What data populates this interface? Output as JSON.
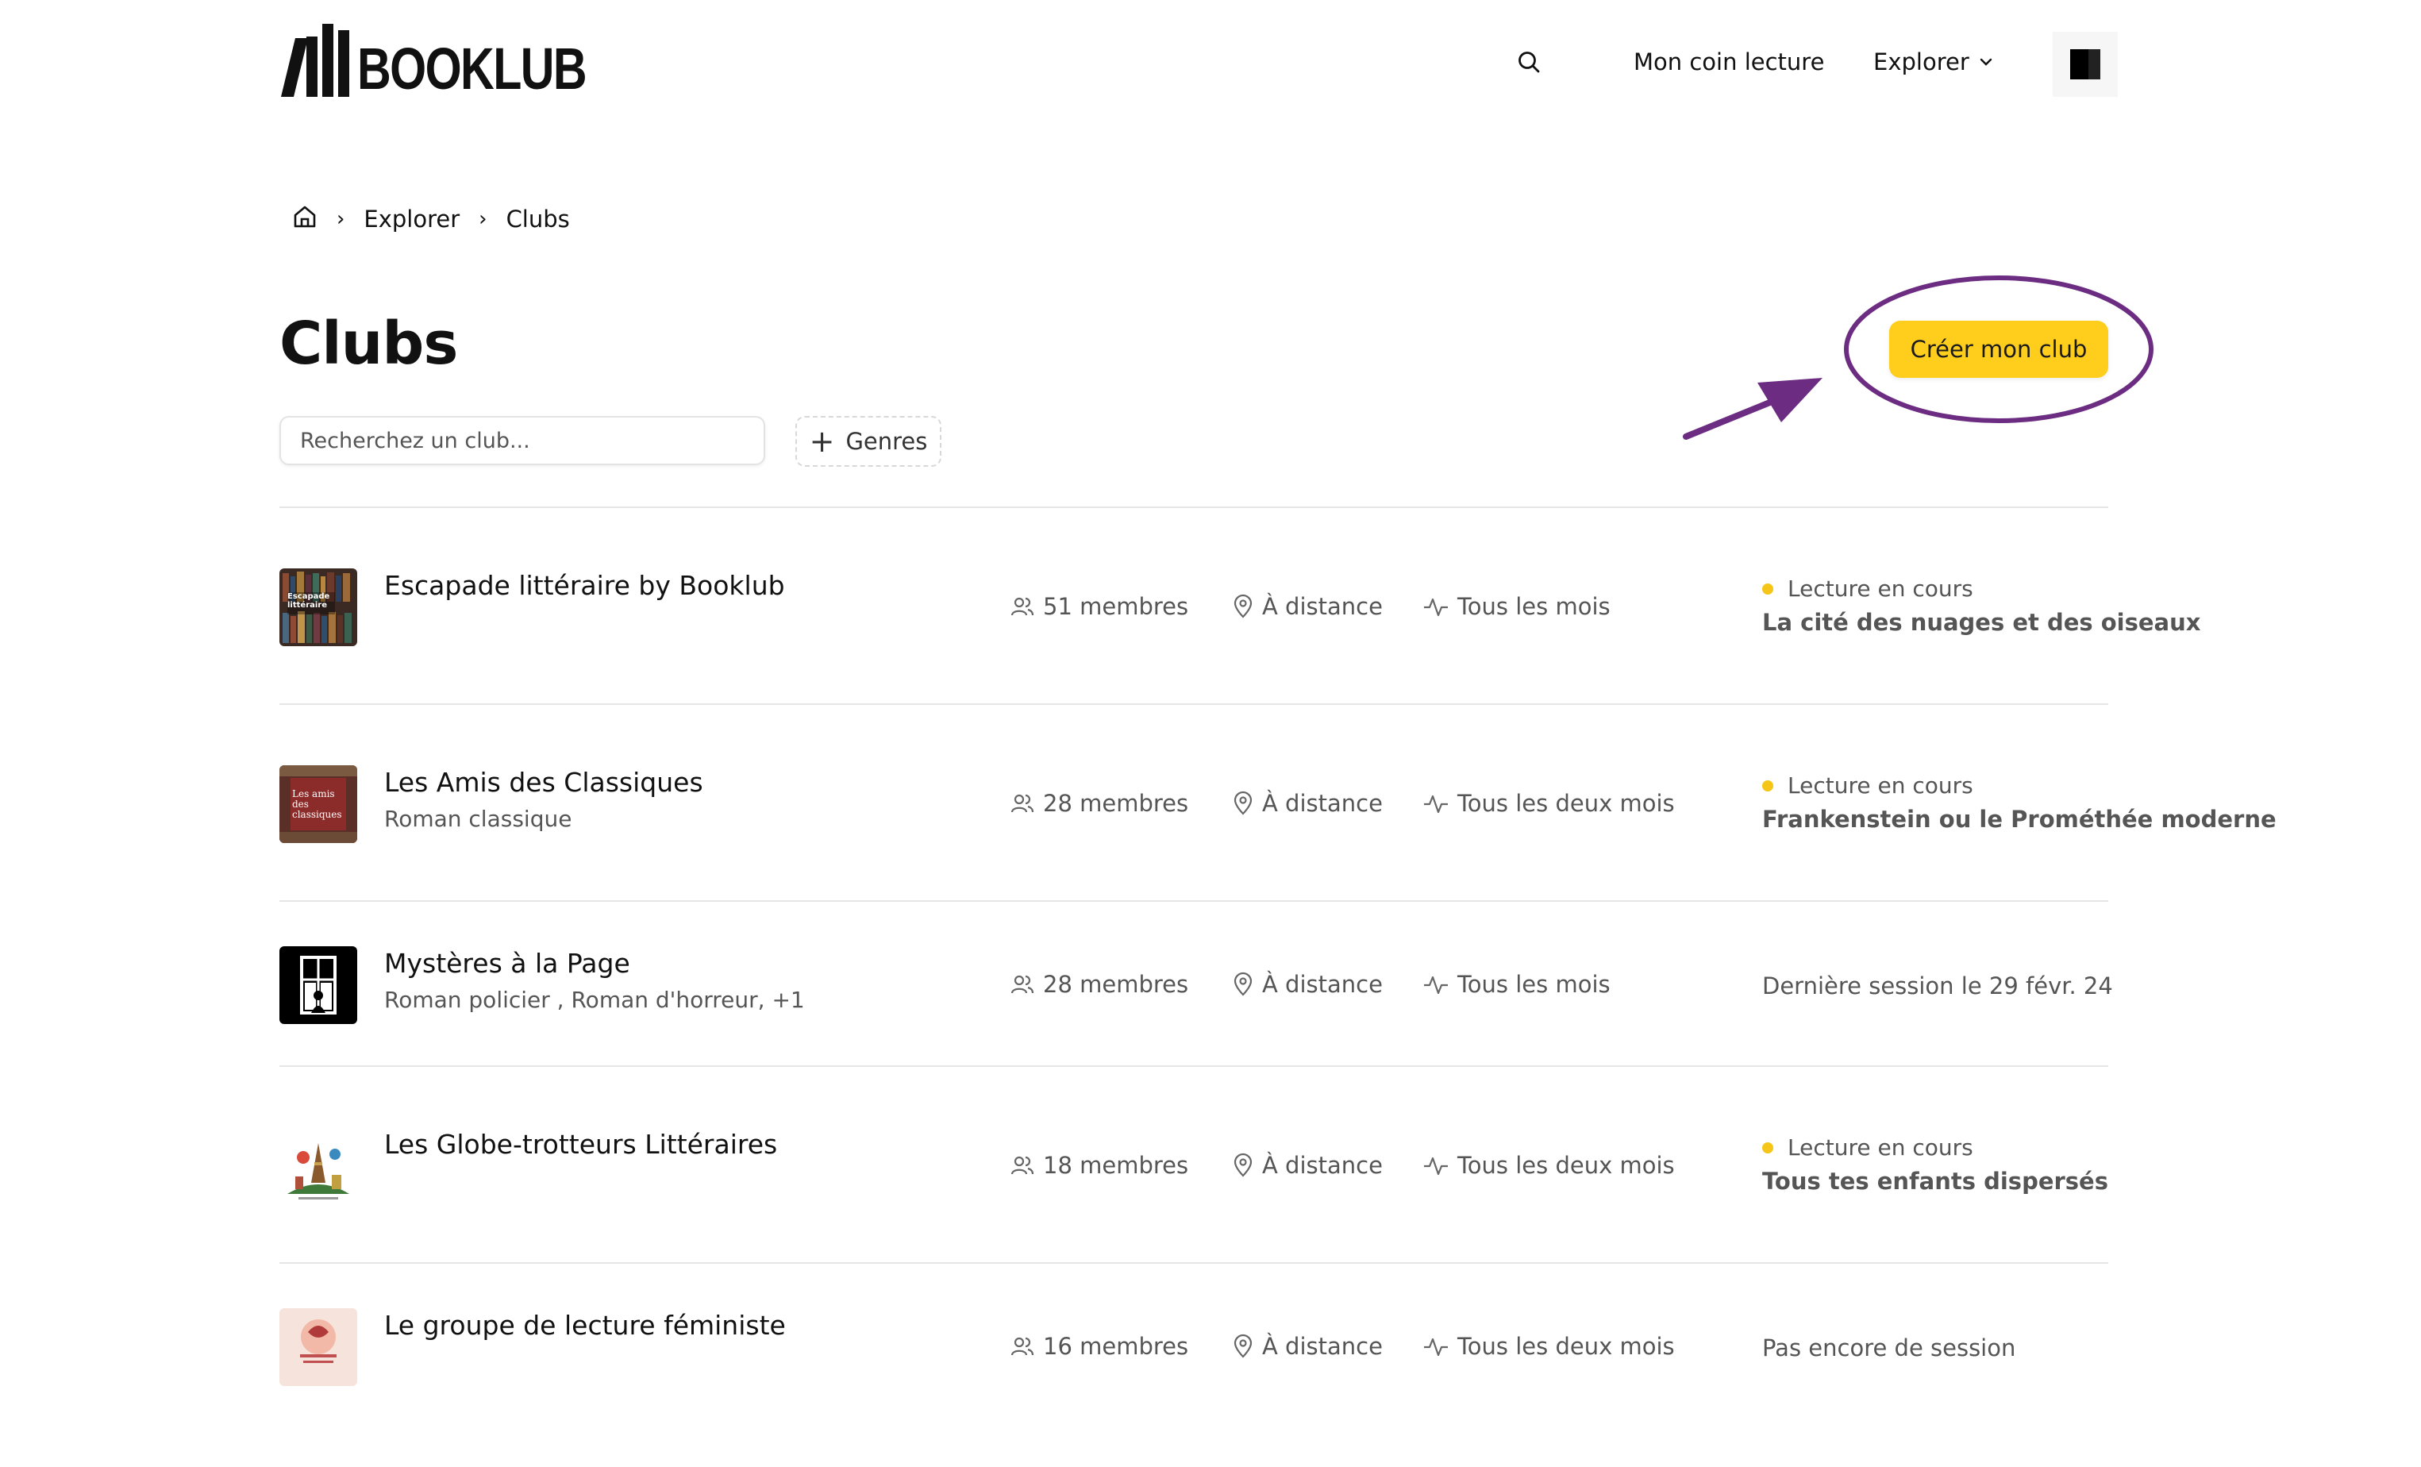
{
  "header": {
    "logo_text": "BOOKLUB",
    "nav": {
      "search_icon": "search-icon",
      "coin_lecture": "Mon coin lecture",
      "explorer": "Explorer"
    }
  },
  "breadcrumb": {
    "home_icon": "home-icon",
    "items": [
      "Explorer",
      "Clubs"
    ]
  },
  "page": {
    "title": "Clubs",
    "search_placeholder": "Recherchez un club...",
    "genres_label": "Genres",
    "create_label": "Créer mon club"
  },
  "colors": {
    "accent_yellow": "#ffcd1c",
    "annotation_purple": "#6b2c82",
    "status_dot": "#f5c518"
  },
  "clubs": [
    {
      "name": "Escapade littéraire by Booklub",
      "genre": "",
      "members": "51 membres",
      "location": "À distance",
      "frequency": "Tous les mois",
      "status_label": "Lecture en cours",
      "book": "La cité des nuages et des oiseaux",
      "cover_text": "Escapade littéraire"
    },
    {
      "name": "Les Amis des Classiques",
      "genre": "Roman classique",
      "members": "28 membres",
      "location": "À distance",
      "frequency": "Tous les deux mois",
      "status_label": "Lecture en cours",
      "book": "Frankenstein ou le Prométhée moderne",
      "cover_text": "Les amis des classiques"
    },
    {
      "name": "Mystères à la Page",
      "genre": "Roman policier , Roman d'horreur, +1",
      "members": "28 membres",
      "location": "À distance",
      "frequency": "Tous les mois",
      "status_text": "Dernière session le 29 févr. 24"
    },
    {
      "name": "Les Globe-trotteurs Littéraires",
      "genre": "",
      "members": "18 membres",
      "location": "À distance",
      "frequency": "Tous les deux mois",
      "status_label": "Lecture en cours",
      "book": "Tous tes enfants dispersés"
    },
    {
      "name": "Le groupe de lecture féministe",
      "genre": "",
      "members": "16 membres",
      "location": "À distance",
      "frequency": "Tous les deux mois",
      "status_text": "Pas encore de session"
    }
  ]
}
